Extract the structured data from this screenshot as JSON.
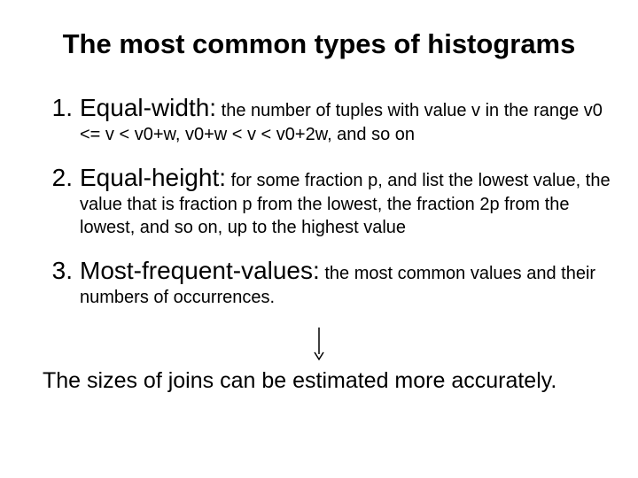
{
  "title": "The most common types of histograms",
  "items": [
    {
      "num": "1.",
      "term": "Equal-width:",
      "desc": " the number of tuples with value v in the range v0 <= v < v0+w, v0+w < v < v0+2w, and so on"
    },
    {
      "num": "2.",
      "term": "Equal-height:",
      "desc": " for some fraction p, and list the lowest value, the value that is fraction p from the lowest, the fraction 2p from the lowest, and so on, up to the highest value"
    },
    {
      "num": "3.",
      "term": "Most-frequent-values:",
      "desc": " the most common values and their numbers of  occurrences."
    }
  ],
  "footer": "The sizes of joins can be estimated more accurately."
}
